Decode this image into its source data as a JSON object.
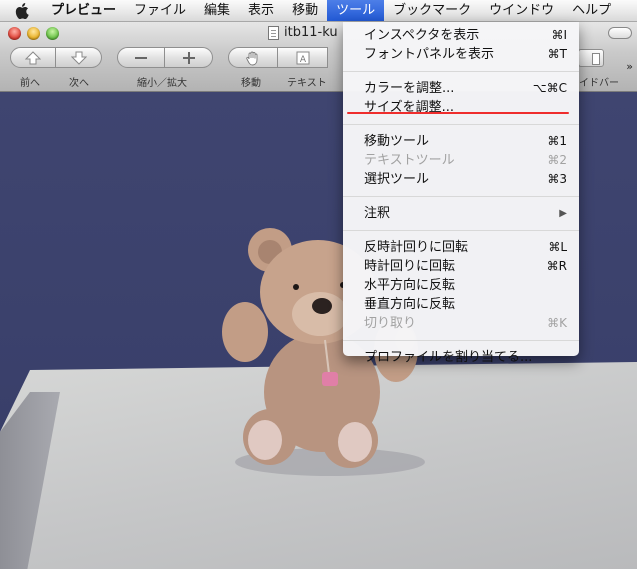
{
  "menubar": {
    "app": "プレビュー",
    "items": [
      "ファイル",
      "編集",
      "表示",
      "移動",
      "ツール",
      "ブックマーク",
      "ウインドウ",
      "ヘルプ"
    ]
  },
  "window": {
    "title": "itb11-ku"
  },
  "toolbar": {
    "prev": "前へ",
    "next": "次へ",
    "zoom": "縮小／拡大",
    "move": "移動",
    "text": "テキスト",
    "sidebar": "イドバー"
  },
  "dropdown": {
    "items": [
      {
        "label": "インスペクタを表示",
        "shortcut": "⌘I",
        "enabled": true
      },
      {
        "label": "フォントパネルを表示",
        "shortcut": "⌘T",
        "enabled": true
      },
      {
        "sep": true
      },
      {
        "label": "カラーを調整...",
        "shortcut": "⌥⌘C",
        "enabled": true
      },
      {
        "label": "サイズを調整...",
        "shortcut": "",
        "enabled": true
      },
      {
        "sep": true
      },
      {
        "label": "移動ツール",
        "shortcut": "⌘1",
        "enabled": true
      },
      {
        "label": "テキストツール",
        "shortcut": "⌘2",
        "enabled": false
      },
      {
        "label": "選択ツール",
        "shortcut": "⌘3",
        "enabled": true
      },
      {
        "sep": true
      },
      {
        "label": "注釈",
        "shortcut": "",
        "enabled": true,
        "submenu": true
      },
      {
        "sep": true
      },
      {
        "label": "反時計回りに回転",
        "shortcut": "⌘L",
        "enabled": true
      },
      {
        "label": "時計回りに回転",
        "shortcut": "⌘R",
        "enabled": true
      },
      {
        "label": "水平方向に反転",
        "shortcut": "",
        "enabled": true
      },
      {
        "label": "垂直方向に反転",
        "shortcut": "",
        "enabled": true
      },
      {
        "label": "切り取り",
        "shortcut": "⌘K",
        "enabled": false
      },
      {
        "sep": true
      },
      {
        "label": "プロファイルを割り当てる...",
        "shortcut": "",
        "enabled": true
      }
    ]
  },
  "colors": {
    "highlight": "#2a5fd8",
    "annotation_underline": "#ef2d2d",
    "backdrop": "#3d4370"
  }
}
